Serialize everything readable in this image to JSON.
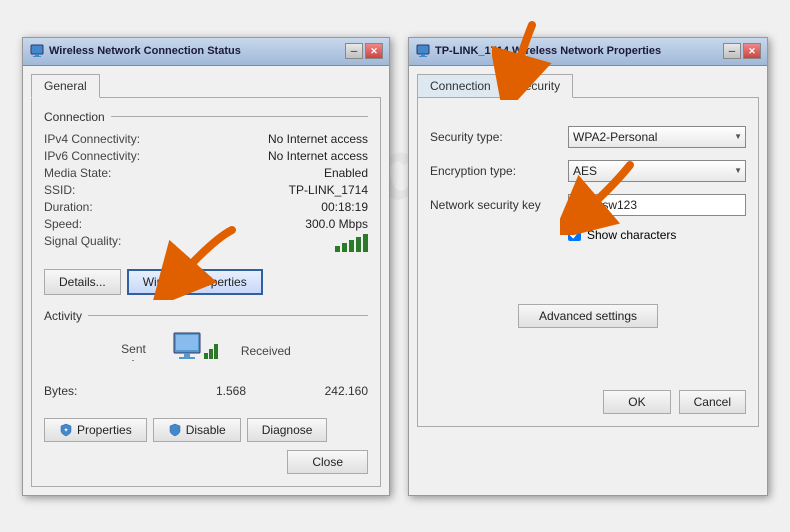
{
  "left_dialog": {
    "title": "Wireless Network Connection Status",
    "tab_general": "General",
    "section_connection": "Connection",
    "fields": [
      {
        "label": "IPv4 Connectivity:",
        "value": "No Internet access"
      },
      {
        "label": "IPv6 Connectivity:",
        "value": "No Internet access"
      },
      {
        "label": "Media State:",
        "value": "Enabled"
      },
      {
        "label": "SSID:",
        "value": "TP-LINK_1714"
      },
      {
        "label": "Duration:",
        "value": "00:18:19"
      },
      {
        "label": "Speed:",
        "value": "300.0 Mbps"
      }
    ],
    "signal_label": "Signal Quality:",
    "btn_details": "Details...",
    "btn_wireless": "Wireless Properties",
    "section_activity": "Activity",
    "sent_label": "Sent",
    "received_label": "Received",
    "bytes_label": "Bytes:",
    "sent_bytes": "1.568",
    "received_bytes": "242.160",
    "btn_properties": "Properties",
    "btn_disable": "Disable",
    "btn_diagnose": "Diagnose",
    "btn_close": "Close"
  },
  "right_dialog": {
    "title": "TP-LINK_1714 Wireless Network Properties",
    "tab_connection": "Connection",
    "tab_security": "Security",
    "security_type_label": "Security type:",
    "security_type_value": "WPA2-Personal",
    "encryption_type_label": "Encryption type:",
    "encryption_type_value": "AES",
    "network_key_label": "Network security key",
    "network_key_value": "mypasw123",
    "show_characters_label": "Show characters",
    "btn_advanced": "Advanced settings",
    "btn_ok": "OK",
    "btn_cancel": "Cancel"
  },
  "watermark": "TP-LINK.com"
}
